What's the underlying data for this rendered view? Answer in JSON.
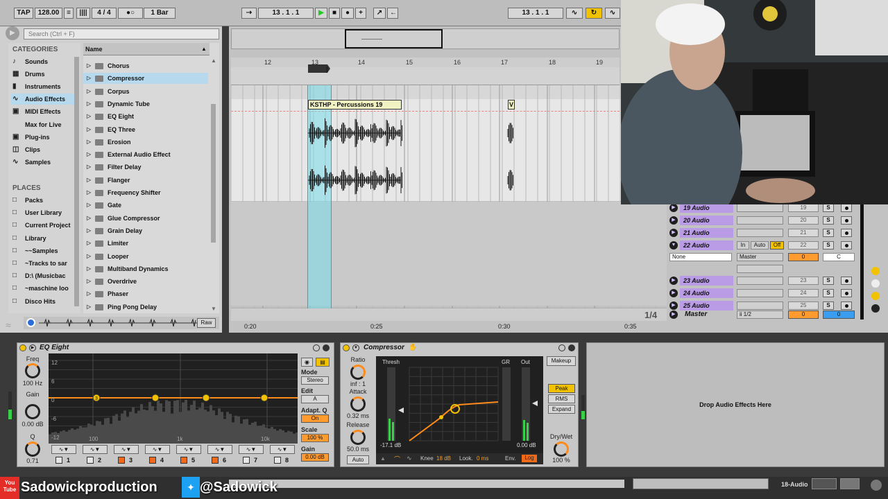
{
  "transport": {
    "tap": "TAP",
    "tempo": "128.00",
    "metronome": "||||",
    "signature": "4 / 4",
    "quantize": "1 Bar",
    "position": "13 .  1 .  1",
    "loop_position": "13 .  1 .  1"
  },
  "browser": {
    "search_placeholder": "Search (Ctrl + F)",
    "categories_heading": "CATEGORIES",
    "categories": [
      "Sounds",
      "Drums",
      "Instruments",
      "Audio Effects",
      "MIDI Effects",
      "Max for Live",
      "Plug-ins",
      "Clips",
      "Samples"
    ],
    "selected_category": "Audio Effects",
    "places_heading": "PLACES",
    "places": [
      "Packs",
      "User Library",
      "Current Project",
      "Library",
      "~~Samples",
      "~Tracks to sar",
      "D:\\ (Musicbac",
      "~maschine loo",
      "Disco Hits"
    ],
    "list_header": "Name",
    "items": [
      "Chorus",
      "Compressor",
      "Corpus",
      "Dynamic Tube",
      "EQ Eight",
      "EQ Three",
      "Erosion",
      "External Audio Effect",
      "Filter Delay",
      "Flanger",
      "Frequency Shifter",
      "Gate",
      "Glue Compressor",
      "Grain Delay",
      "Limiter",
      "Looper",
      "Multiband Dynamics",
      "Overdrive",
      "Phaser",
      "Ping Pong Delay"
    ],
    "selected_item": "Compressor",
    "raw_label": "Raw"
  },
  "arrangement": {
    "bar_numbers": [
      "12",
      "13",
      "14",
      "15",
      "16",
      "17",
      "18",
      "19"
    ],
    "clip_name": "KSTHP - Percussions 19",
    "clip2_name": "V",
    "time_labels": [
      "0:20",
      "0:25",
      "0:30",
      "0:35"
    ],
    "page_indicator": "1/4"
  },
  "tracks": [
    {
      "name": "19 Audio",
      "num": "19"
    },
    {
      "name": "20 Audio",
      "num": "20"
    },
    {
      "name": "21 Audio",
      "num": "21"
    },
    {
      "name": "22 Audio",
      "num": "22",
      "in": "In",
      "auto": "Auto",
      "off": "Off",
      "input": "None",
      "output": "Master",
      "vol": "0",
      "pan": "C"
    },
    {
      "name": "23 Audio",
      "num": "23"
    },
    {
      "name": "24 Audio",
      "num": "24"
    },
    {
      "name": "25 Audio",
      "num": "25"
    }
  ],
  "master": {
    "name": "Master",
    "routing": "ii 1/2",
    "vol": "0",
    "pan": "0"
  },
  "solo_label": "S",
  "eq": {
    "title": "EQ Eight",
    "freq_label": "Freq",
    "freq_value": "100 Hz",
    "gain_label": "Gain",
    "gain_value": "0.00 dB",
    "q_label": "Q",
    "q_value": "0.71",
    "db_ticks": [
      "12",
      "6",
      "0",
      "-6",
      "-12"
    ],
    "freq_ticks": [
      "100",
      "1k",
      "10k"
    ],
    "mode_label": "Mode",
    "mode_value": "Stereo",
    "edit_label": "Edit",
    "edit_value": "A",
    "adaptq_label": "Adapt. Q",
    "adaptq_value": "On",
    "scale_label": "Scale",
    "scale_value": "100 %",
    "gain2_label": "Gain",
    "gain2_value": "0.00 dB",
    "bands": [
      "1",
      "2",
      "3",
      "4",
      "5",
      "6",
      "7",
      "8"
    ],
    "band_point_label": "3"
  },
  "comp": {
    "title": "Compressor",
    "ratio_label": "Ratio",
    "ratio_value": "inf : 1",
    "attack_label": "Attack",
    "attack_value": "0.32 ms",
    "release_label": "Release",
    "release_value": "50.0 ms",
    "auto_label": "Auto",
    "thresh_label": "Thresh",
    "gr_label": "GR",
    "out_label": "Out",
    "thresh_value": "-17.1 dB",
    "out_value": "0.00 dB",
    "knee_label": "Knee",
    "knee_value": "18 dB",
    "look_label": "Look.",
    "look_value": "0 ms",
    "env_label": "Env.",
    "env_value": "Log",
    "makeup": "Makeup",
    "peak": "Peak",
    "rms": "RMS",
    "expand": "Expand",
    "drywet_label": "Dry/Wet",
    "drywet_value": "100 %"
  },
  "dropzone_text": "Drop Audio Effects Here",
  "status": {
    "track": "18-Audio"
  },
  "overlay": {
    "youtube": "Sadowickproduction",
    "twitter": "@Sadowick",
    "yt_icon_text": "You Tube"
  }
}
